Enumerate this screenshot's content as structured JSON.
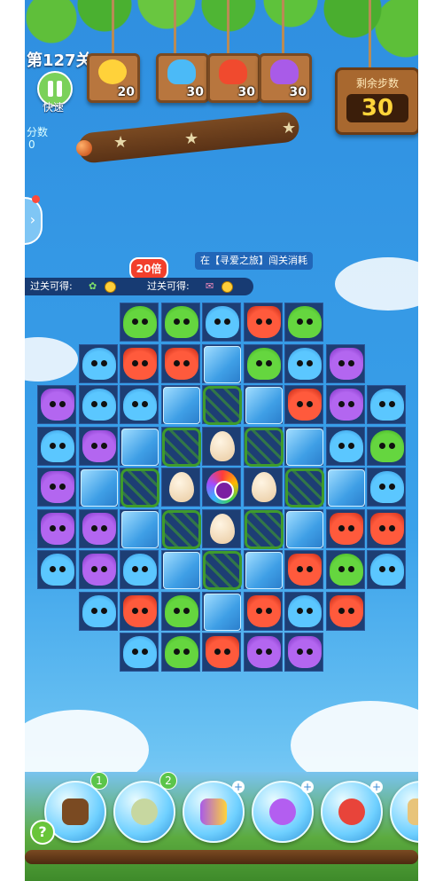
{
  "hud": {
    "level_label": "第127关",
    "speed_label": "快速",
    "score_label": "分数",
    "score_value": "0",
    "goals": [
      {
        "icon": "chick-icon",
        "count": "20"
      },
      {
        "icon": "blue-cat-icon",
        "count": "30"
      },
      {
        "icon": "red-fox-icon",
        "count": "30"
      },
      {
        "icon": "purple-owl-icon",
        "count": "30"
      }
    ],
    "steps_label": "剩余步数",
    "steps_value": "30"
  },
  "event": {
    "multiplier": "20倍",
    "tip": "在【寻爱之旅】闯关消耗",
    "reward_left": "过关可得:",
    "reward_right": "过关可得:"
  },
  "tools": [
    {
      "name": "shuffle-tool",
      "badge": "1"
    },
    {
      "name": "extra-moves-tool",
      "badge": "2"
    },
    {
      "name": "swap-tool",
      "badge": "+"
    },
    {
      "name": "rocket-horizontal-tool",
      "badge": "+"
    },
    {
      "name": "rocket-vertical-tool",
      "badge": "+"
    },
    {
      "name": "hammer-tool",
      "badge": "+"
    }
  ],
  "board": {
    "rows": [
      [
        "",
        "",
        "frog",
        "frog",
        "blue",
        "fox",
        "frog",
        "",
        "",
        ""
      ],
      [
        "",
        "blue",
        "fox",
        "fox",
        "ice",
        "frog",
        "blue",
        "owl",
        "",
        ""
      ],
      [
        "owl",
        "blue",
        "blue",
        "ice",
        "vine",
        "ice",
        "fox",
        "owl",
        "blue",
        ""
      ],
      [
        "blue",
        "owl",
        "ice",
        "vine",
        "egg",
        "vine",
        "ice",
        "blue",
        "frog",
        ""
      ],
      [
        "owl",
        "ice",
        "vine",
        "egg",
        "bird",
        "egg",
        "vine",
        "ice",
        "blue",
        ""
      ],
      [
        "owl",
        "owl",
        "ice",
        "vine",
        "egg",
        "vine",
        "ice",
        "fox",
        "fox",
        ""
      ],
      [
        "blue",
        "owl",
        "blue",
        "ice",
        "vine",
        "ice",
        "fox",
        "frog",
        "blue",
        ""
      ],
      [
        "",
        "blue",
        "fox",
        "frog",
        "ice",
        "fox",
        "blue",
        "fox",
        "",
        ""
      ],
      [
        "",
        "",
        "blue",
        "frog",
        "fox",
        "owl",
        "owl",
        "",
        "",
        ""
      ]
    ]
  },
  "colors": {
    "accent": "#ffd43a",
    "wood": "#a8682f",
    "board": "#1d3e74"
  }
}
